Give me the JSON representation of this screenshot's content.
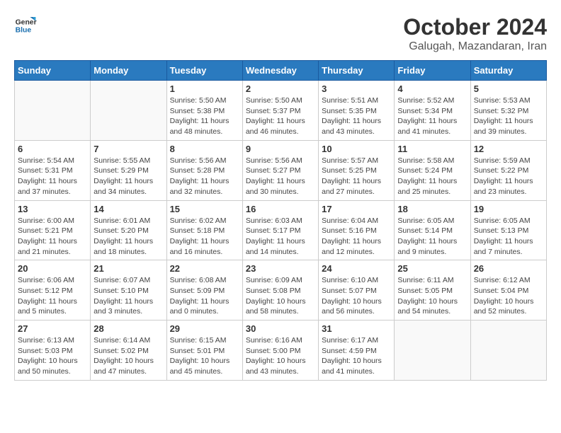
{
  "header": {
    "logo_line1": "General",
    "logo_line2": "Blue",
    "title": "October 2024",
    "subtitle": "Galugah, Mazandaran, Iran"
  },
  "weekdays": [
    "Sunday",
    "Monday",
    "Tuesday",
    "Wednesday",
    "Thursday",
    "Friday",
    "Saturday"
  ],
  "weeks": [
    [
      {
        "day": "",
        "sunrise": "",
        "sunset": "",
        "daylight": ""
      },
      {
        "day": "",
        "sunrise": "",
        "sunset": "",
        "daylight": ""
      },
      {
        "day": "1",
        "sunrise": "Sunrise: 5:50 AM",
        "sunset": "Sunset: 5:38 PM",
        "daylight": "Daylight: 11 hours and 48 minutes."
      },
      {
        "day": "2",
        "sunrise": "Sunrise: 5:50 AM",
        "sunset": "Sunset: 5:37 PM",
        "daylight": "Daylight: 11 hours and 46 minutes."
      },
      {
        "day": "3",
        "sunrise": "Sunrise: 5:51 AM",
        "sunset": "Sunset: 5:35 PM",
        "daylight": "Daylight: 11 hours and 43 minutes."
      },
      {
        "day": "4",
        "sunrise": "Sunrise: 5:52 AM",
        "sunset": "Sunset: 5:34 PM",
        "daylight": "Daylight: 11 hours and 41 minutes."
      },
      {
        "day": "5",
        "sunrise": "Sunrise: 5:53 AM",
        "sunset": "Sunset: 5:32 PM",
        "daylight": "Daylight: 11 hours and 39 minutes."
      }
    ],
    [
      {
        "day": "6",
        "sunrise": "Sunrise: 5:54 AM",
        "sunset": "Sunset: 5:31 PM",
        "daylight": "Daylight: 11 hours and 37 minutes."
      },
      {
        "day": "7",
        "sunrise": "Sunrise: 5:55 AM",
        "sunset": "Sunset: 5:29 PM",
        "daylight": "Daylight: 11 hours and 34 minutes."
      },
      {
        "day": "8",
        "sunrise": "Sunrise: 5:56 AM",
        "sunset": "Sunset: 5:28 PM",
        "daylight": "Daylight: 11 hours and 32 minutes."
      },
      {
        "day": "9",
        "sunrise": "Sunrise: 5:56 AM",
        "sunset": "Sunset: 5:27 PM",
        "daylight": "Daylight: 11 hours and 30 minutes."
      },
      {
        "day": "10",
        "sunrise": "Sunrise: 5:57 AM",
        "sunset": "Sunset: 5:25 PM",
        "daylight": "Daylight: 11 hours and 27 minutes."
      },
      {
        "day": "11",
        "sunrise": "Sunrise: 5:58 AM",
        "sunset": "Sunset: 5:24 PM",
        "daylight": "Daylight: 11 hours and 25 minutes."
      },
      {
        "day": "12",
        "sunrise": "Sunrise: 5:59 AM",
        "sunset": "Sunset: 5:22 PM",
        "daylight": "Daylight: 11 hours and 23 minutes."
      }
    ],
    [
      {
        "day": "13",
        "sunrise": "Sunrise: 6:00 AM",
        "sunset": "Sunset: 5:21 PM",
        "daylight": "Daylight: 11 hours and 21 minutes."
      },
      {
        "day": "14",
        "sunrise": "Sunrise: 6:01 AM",
        "sunset": "Sunset: 5:20 PM",
        "daylight": "Daylight: 11 hours and 18 minutes."
      },
      {
        "day": "15",
        "sunrise": "Sunrise: 6:02 AM",
        "sunset": "Sunset: 5:18 PM",
        "daylight": "Daylight: 11 hours and 16 minutes."
      },
      {
        "day": "16",
        "sunrise": "Sunrise: 6:03 AM",
        "sunset": "Sunset: 5:17 PM",
        "daylight": "Daylight: 11 hours and 14 minutes."
      },
      {
        "day": "17",
        "sunrise": "Sunrise: 6:04 AM",
        "sunset": "Sunset: 5:16 PM",
        "daylight": "Daylight: 11 hours and 12 minutes."
      },
      {
        "day": "18",
        "sunrise": "Sunrise: 6:05 AM",
        "sunset": "Sunset: 5:14 PM",
        "daylight": "Daylight: 11 hours and 9 minutes."
      },
      {
        "day": "19",
        "sunrise": "Sunrise: 6:05 AM",
        "sunset": "Sunset: 5:13 PM",
        "daylight": "Daylight: 11 hours and 7 minutes."
      }
    ],
    [
      {
        "day": "20",
        "sunrise": "Sunrise: 6:06 AM",
        "sunset": "Sunset: 5:12 PM",
        "daylight": "Daylight: 11 hours and 5 minutes."
      },
      {
        "day": "21",
        "sunrise": "Sunrise: 6:07 AM",
        "sunset": "Sunset: 5:10 PM",
        "daylight": "Daylight: 11 hours and 3 minutes."
      },
      {
        "day": "22",
        "sunrise": "Sunrise: 6:08 AM",
        "sunset": "Sunset: 5:09 PM",
        "daylight": "Daylight: 11 hours and 0 minutes."
      },
      {
        "day": "23",
        "sunrise": "Sunrise: 6:09 AM",
        "sunset": "Sunset: 5:08 PM",
        "daylight": "Daylight: 10 hours and 58 minutes."
      },
      {
        "day": "24",
        "sunrise": "Sunrise: 6:10 AM",
        "sunset": "Sunset: 5:07 PM",
        "daylight": "Daylight: 10 hours and 56 minutes."
      },
      {
        "day": "25",
        "sunrise": "Sunrise: 6:11 AM",
        "sunset": "Sunset: 5:05 PM",
        "daylight": "Daylight: 10 hours and 54 minutes."
      },
      {
        "day": "26",
        "sunrise": "Sunrise: 6:12 AM",
        "sunset": "Sunset: 5:04 PM",
        "daylight": "Daylight: 10 hours and 52 minutes."
      }
    ],
    [
      {
        "day": "27",
        "sunrise": "Sunrise: 6:13 AM",
        "sunset": "Sunset: 5:03 PM",
        "daylight": "Daylight: 10 hours and 50 minutes."
      },
      {
        "day": "28",
        "sunrise": "Sunrise: 6:14 AM",
        "sunset": "Sunset: 5:02 PM",
        "daylight": "Daylight: 10 hours and 47 minutes."
      },
      {
        "day": "29",
        "sunrise": "Sunrise: 6:15 AM",
        "sunset": "Sunset: 5:01 PM",
        "daylight": "Daylight: 10 hours and 45 minutes."
      },
      {
        "day": "30",
        "sunrise": "Sunrise: 6:16 AM",
        "sunset": "Sunset: 5:00 PM",
        "daylight": "Daylight: 10 hours and 43 minutes."
      },
      {
        "day": "31",
        "sunrise": "Sunrise: 6:17 AM",
        "sunset": "Sunset: 4:59 PM",
        "daylight": "Daylight: 10 hours and 41 minutes."
      },
      {
        "day": "",
        "sunrise": "",
        "sunset": "",
        "daylight": ""
      },
      {
        "day": "",
        "sunrise": "",
        "sunset": "",
        "daylight": ""
      }
    ]
  ]
}
